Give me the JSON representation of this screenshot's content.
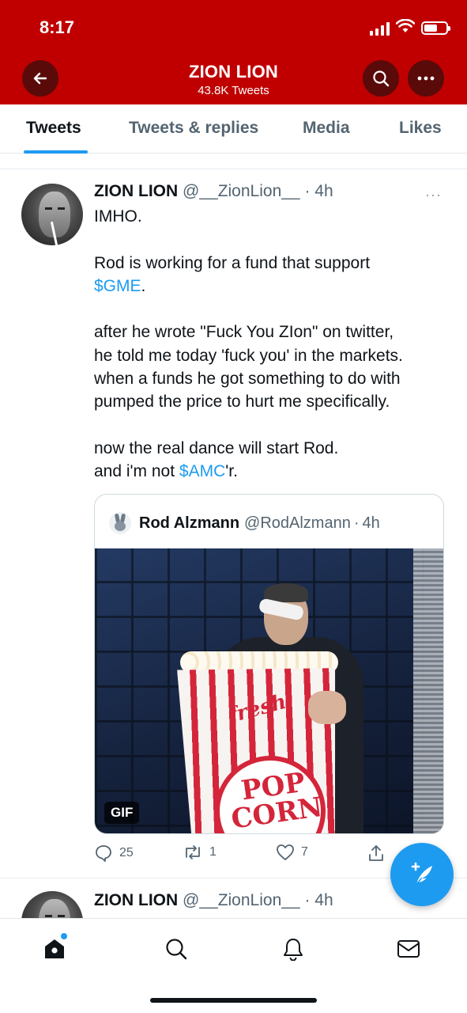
{
  "status_bar": {
    "time": "8:17"
  },
  "header": {
    "title": "ZION LION",
    "subtitle": "43.8K Tweets",
    "accent_color": "#c00000"
  },
  "tabs": [
    {
      "label": "Tweets",
      "active": true
    },
    {
      "label": "Tweets & replies",
      "active": false
    },
    {
      "label": "Media",
      "active": false
    },
    {
      "label": "Likes",
      "active": false
    }
  ],
  "tweets": [
    {
      "name": "ZION LION",
      "handle": "@__ZionLion__",
      "sep": "·",
      "time": "4h",
      "more": "···",
      "body": {
        "l1": "IMHO.",
        "l2": "Rod is working for a fund that support",
        "l3_tag": "$GME",
        "l3_rest": ".",
        "l4": "after he wrote \"Fuck You ZIon\" on twitter,",
        "l5": "he told me today 'fuck you' in the markets.",
        "l6": "when a funds he got something to do with",
        "l7": "pumped the price to hurt me specifically.",
        "l8": "now the real dance will start Rod.",
        "l9_pre": "and i'm not ",
        "l9_tag": "$AMC",
        "l9_post": "'r."
      },
      "quote": {
        "name": "Rod Alzmann",
        "handle": "@RodAlzmann",
        "sep": "·",
        "time": "4h",
        "media_badge": "GIF",
        "media_text_1": "fresh",
        "media_text_2": "POP CORN"
      },
      "actions": {
        "replies": "25",
        "retweets": "1",
        "likes": "7"
      }
    },
    {
      "name": "ZION LION",
      "handle": "@__ZionLion__",
      "sep": "·",
      "time": "4h"
    }
  ],
  "fab": {
    "icon": "compose-tweet-icon"
  },
  "bottom_nav": [
    {
      "icon": "home-icon",
      "has_dot": true
    },
    {
      "icon": "search-icon"
    },
    {
      "icon": "bell-icon"
    },
    {
      "icon": "mail-icon"
    }
  ],
  "colors": {
    "link": "#1d9bf0",
    "muted": "#536471",
    "text": "#0f1419"
  }
}
